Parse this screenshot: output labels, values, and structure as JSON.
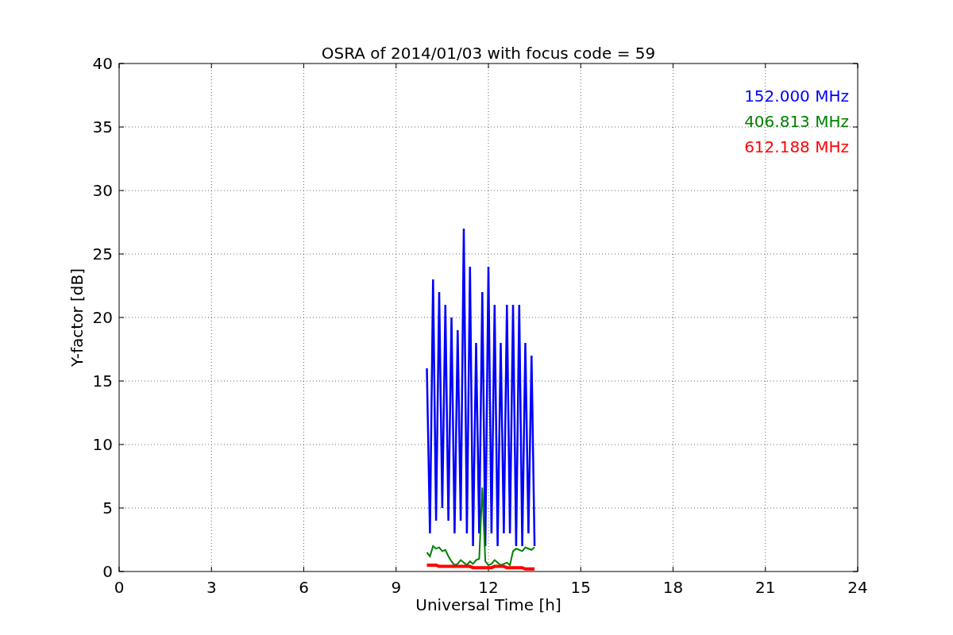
{
  "chart_data": {
    "type": "line",
    "grid": true,
    "title": "OSRA of 2014/01/03 with focus code = 59",
    "xlabel": "Universal Time [h]",
    "ylabel": "Y-factor [dB]",
    "xlim": [
      0,
      24
    ],
    "ylim": [
      0,
      40
    ],
    "xticks": [
      0,
      3,
      6,
      9,
      12,
      15,
      18,
      21,
      24
    ],
    "yticks": [
      0,
      5,
      10,
      15,
      20,
      25,
      30,
      35,
      40
    ],
    "x": [
      10.0,
      10.1,
      10.2,
      10.3,
      10.4,
      10.5,
      10.6,
      10.7,
      10.8,
      10.9,
      11.0,
      11.1,
      11.2,
      11.3,
      11.4,
      11.5,
      11.6,
      11.7,
      11.8,
      11.9,
      12.0,
      12.1,
      12.2,
      12.3,
      12.4,
      12.5,
      12.6,
      12.7,
      12.8,
      12.9,
      13.0,
      13.1,
      13.2,
      13.3,
      13.4,
      13.5
    ],
    "series": [
      {
        "name": "152.000 MHz",
        "color": "#0000ff",
        "values": [
          16,
          3,
          23,
          4,
          22,
          5,
          21,
          4,
          20,
          3,
          19,
          4,
          27,
          3,
          24,
          2,
          18,
          3,
          22,
          2,
          24,
          3,
          21,
          2,
          18,
          3,
          21,
          3,
          21,
          2,
          21,
          2,
          18,
          3,
          17,
          2
        ]
      },
      {
        "name": "406.813 MHz",
        "color": "#008000",
        "values": [
          1.5,
          1.2,
          2.0,
          1.8,
          1.9,
          1.6,
          1.7,
          1.2,
          0.8,
          0.5,
          0.6,
          0.9,
          0.7,
          0.5,
          0.8,
          0.6,
          0.9,
          1.0,
          6.6,
          0.8,
          0.5,
          0.6,
          0.9,
          0.7,
          0.5,
          0.6,
          0.7,
          0.5,
          1.6,
          1.8,
          1.7,
          1.6,
          1.9,
          1.8,
          1.7,
          1.9
        ]
      },
      {
        "name": "612.188 MHz",
        "color": "#ff0000",
        "values": [
          0.5,
          0.5,
          0.5,
          0.5,
          0.4,
          0.4,
          0.4,
          0.4,
          0.4,
          0.4,
          0.4,
          0.4,
          0.4,
          0.4,
          0.4,
          0.3,
          0.3,
          0.3,
          0.3,
          0.3,
          0.3,
          0.3,
          0.4,
          0.4,
          0.4,
          0.4,
          0.3,
          0.3,
          0.3,
          0.3,
          0.3,
          0.3,
          0.2,
          0.2,
          0.2,
          0.2
        ]
      }
    ]
  }
}
